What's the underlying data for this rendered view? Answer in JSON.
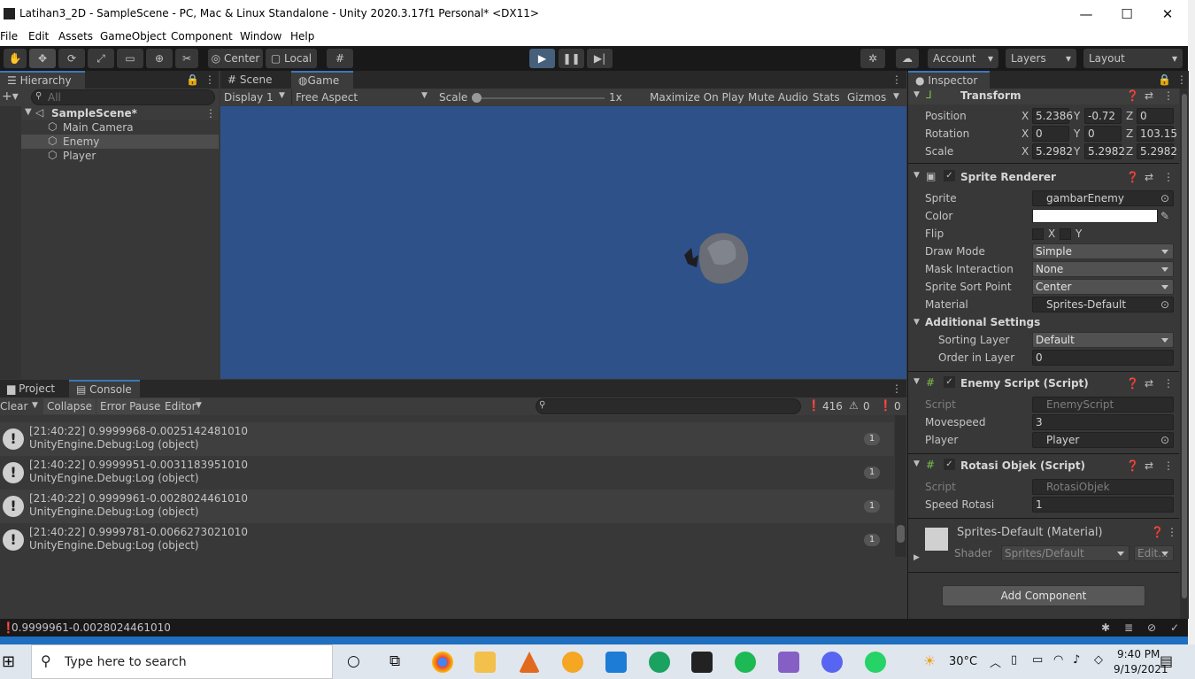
{
  "window": {
    "title": "Latihan3_2D - SampleScene - PC, Mac & Linux Standalone - Unity 2020.3.17f1 Personal* <DX11>",
    "minimize": "—",
    "maximize": "☐",
    "close": "✕"
  },
  "menu": [
    "File",
    "Edit",
    "Assets",
    "GameObject",
    "Component",
    "Window",
    "Help"
  ],
  "toolbar": {
    "center": "Center",
    "local": "Local",
    "account": "Account",
    "layers": "Layers",
    "layout": "Layout"
  },
  "hierarchy": {
    "tab": "Hierarchy",
    "search_placeholder": "All",
    "scene": "SampleScene*",
    "items": [
      "Main Camera",
      "Enemy",
      "Player"
    ]
  },
  "scene_view": {
    "tabs": [
      "Scene",
      "Game"
    ],
    "display": "Display 1",
    "aspect": "Free Aspect",
    "scale_label": "Scale",
    "scale_value": "1x",
    "maximize_on_play": "Maximize On Play",
    "mute_audio": "Mute Audio",
    "stats": "Stats",
    "gizmos": "Gizmos"
  },
  "console": {
    "tabs": [
      "Project",
      "Console"
    ],
    "clear": "Clear",
    "collapse": "Collapse",
    "error_pause": "Error Pause",
    "editor": "Editor",
    "count_log": "416",
    "count_warn": "0",
    "count_err": "0",
    "logs": [
      {
        "line1": "[21:40:22] 0.9999968-0.0025142481010",
        "line2": "UnityEngine.Debug:Log (object)",
        "count": "1"
      },
      {
        "line1": "[21:40:22] 0.9999951-0.0031183951010",
        "line2": "UnityEngine.Debug:Log (object)",
        "count": "1"
      },
      {
        "line1": "[21:40:22] 0.9999961-0.0028024461010",
        "line2": "UnityEngine.Debug:Log (object)",
        "count": "1"
      },
      {
        "line1": "[21:40:22] 0.9999781-0.0066273021010",
        "line2": "UnityEngine.Debug:Log (object)",
        "count": "1"
      }
    ],
    "status": "0.9999961-0.0028024461010"
  },
  "inspector": {
    "tab": "Inspector",
    "transform": {
      "title": "Transform",
      "position": {
        "label": "Position",
        "x": "5.2386",
        "y": "-0.72",
        "z": "0"
      },
      "rotation": {
        "label": "Rotation",
        "x": "0",
        "y": "0",
        "z": "103.15"
      },
      "scale": {
        "label": "Scale",
        "x": "5.2982",
        "y": "5.2982",
        "z": "5.2982"
      }
    },
    "sprite_renderer": {
      "title": "Sprite Renderer",
      "sprite_label": "Sprite",
      "sprite": "gambarEnemy",
      "color_label": "Color",
      "flip_label": "Flip",
      "flip_x": "X",
      "flip_y": "Y",
      "draw_mode_label": "Draw Mode",
      "draw_mode": "Simple",
      "mask_label": "Mask Interaction",
      "mask": "None",
      "sort_point_label": "Sprite Sort Point",
      "sort_point": "Center",
      "material_label": "Material",
      "material": "Sprites-Default",
      "additional": "Additional Settings",
      "sorting_layer_label": "Sorting Layer",
      "sorting_layer": "Default",
      "order_label": "Order in Layer",
      "order": "0"
    },
    "enemy_script": {
      "title": "Enemy Script (Script)",
      "script_label": "Script",
      "script": "EnemyScript",
      "movespeed_label": "Movespeed",
      "movespeed": "3",
      "player_label": "Player",
      "player": "Player"
    },
    "rotasi": {
      "title": "Rotasi Objek (Script)",
      "script_label": "Script",
      "script": "RotasiObjek",
      "speed_label": "Speed Rotasi",
      "speed": "1"
    },
    "material_block": {
      "title": "Sprites-Default (Material)",
      "shader_label": "Shader",
      "shader": "Sprites/Default",
      "edit": "Edit..."
    },
    "add_component": "Add Component"
  },
  "taskbar": {
    "search_placeholder": "Type here to search",
    "temperature": "30°C",
    "time": "9:40 PM",
    "date": "9/19/2021"
  },
  "colors": {
    "game_bg": "#2e5189",
    "accent": "#3a79bb",
    "panel": "#383838",
    "toolbar": "#191919"
  }
}
